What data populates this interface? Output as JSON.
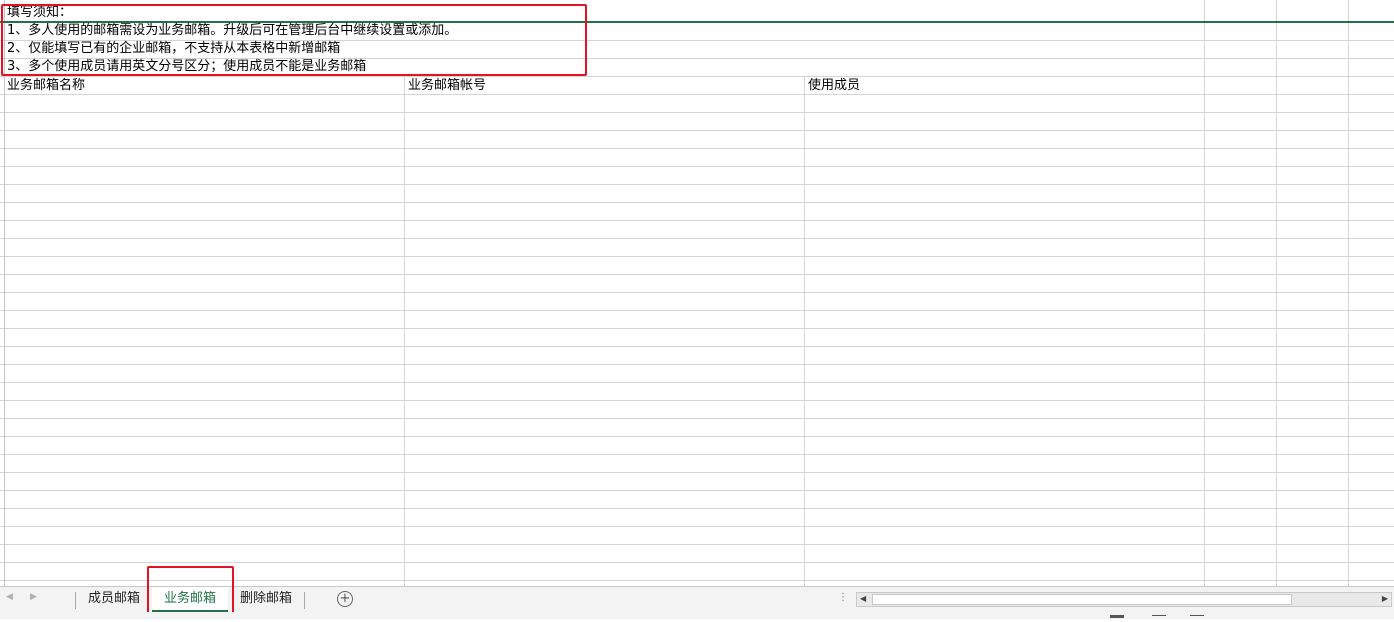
{
  "notice": {
    "title": "填写须知：",
    "lines": [
      "1、多人使用的邮箱需设为业务邮箱。升级后可在管理后台中继续设置或添加。",
      "2、仅能填写已有的企业邮箱，不支持从本表格中新增邮箱",
      "3、多个使用成员请用英文分号区分；使用成员不能是业务邮箱"
    ]
  },
  "columns": [
    "业务邮箱名称",
    "业务邮箱帐号",
    "使用成员"
  ],
  "sheet_tabs": [
    {
      "label": "成员邮箱",
      "active": false
    },
    {
      "label": "业务邮箱",
      "active": true
    },
    {
      "label": "删除邮箱",
      "active": false
    }
  ],
  "icons": {
    "prev_sheet": "prev-sheet-icon",
    "next_sheet": "next-sheet-icon",
    "add_sheet": "add-sheet-icon"
  },
  "colors": {
    "accent": "#217346",
    "highlight": "#e81123"
  }
}
